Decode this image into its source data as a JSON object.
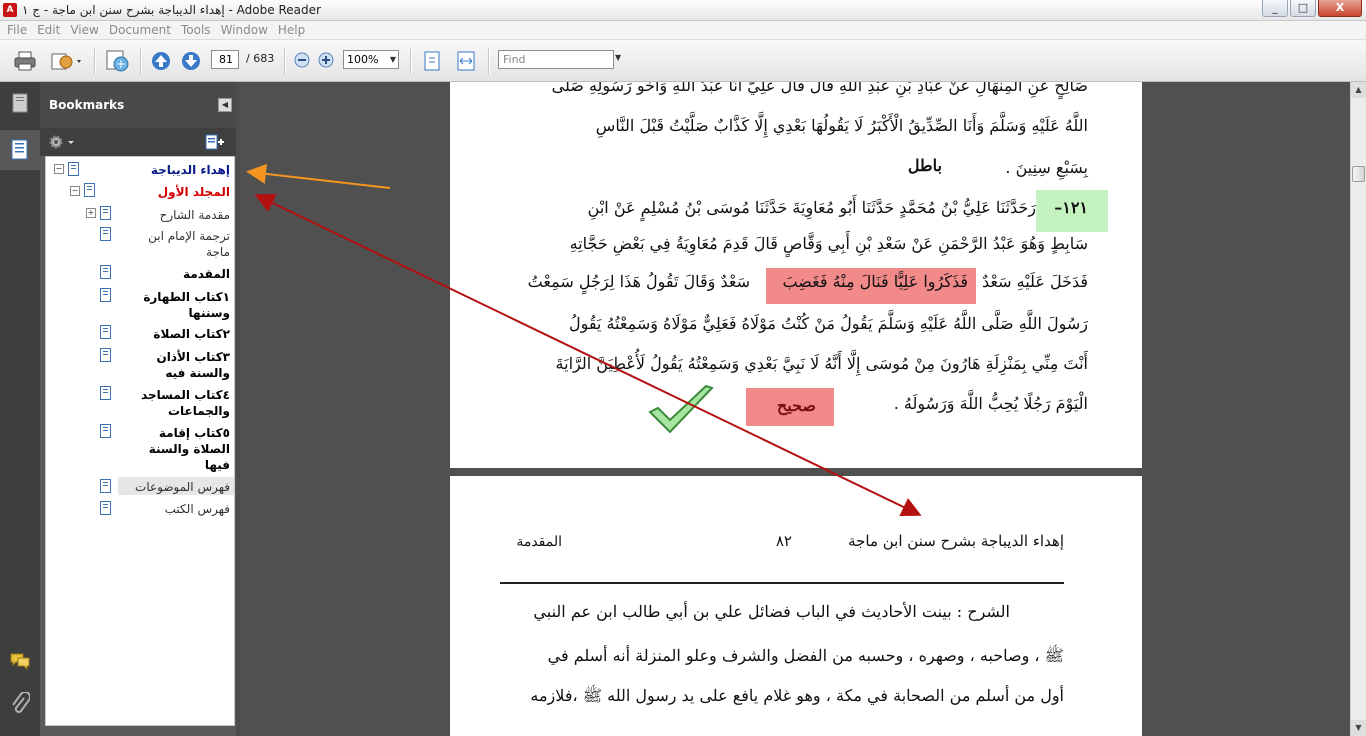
{
  "window": {
    "title": "إهداء الديباجة بشرح سنن ابن ماجة - ج ١ - Adobe Reader",
    "controls": {
      "minimize": "_",
      "maximize": "□",
      "close": "X"
    }
  },
  "menu": [
    "File",
    "Edit",
    "View",
    "Document",
    "Tools",
    "Window",
    "Help"
  ],
  "toolbar": {
    "page_current": "81",
    "page_total": "/ 683",
    "zoom": "100%",
    "find_placeholder": "Find"
  },
  "panel": {
    "title": "Bookmarks",
    "bookmarks": [
      {
        "label": "إهداء الديباجة",
        "color": "#0a1a8c"
      },
      {
        "label": "المجلد الأول",
        "color": "#d40000"
      },
      {
        "label": "مقدمة الشارح",
        "color": "#333333"
      },
      {
        "label": "ترجمة الإمام ابن",
        "label2": "ماجة",
        "color": "#333333"
      },
      {
        "label": "المقدمة",
        "color": "#000000"
      },
      {
        "label": "١كتاب الطهارة",
        "label2": "وسننها",
        "color": "#000000"
      },
      {
        "label": "٢كتاب الصلاة",
        "color": "#000000"
      },
      {
        "label": "٣كتاب الأذان",
        "label2": "والسنة فيه",
        "color": "#000000"
      },
      {
        "label": "٤كتاب المساجد",
        "label2": "والجماعات",
        "color": "#000000"
      },
      {
        "label": "٥كتاب إقامة",
        "label2": "الصلاة والسنة",
        "label3": "فيها",
        "color": "#000000"
      },
      {
        "label": "فهرس الموضوعات",
        "color": "#333333"
      },
      {
        "label": "فهرس الكتب",
        "color": "#333333"
      }
    ]
  },
  "page1": {
    "lines": [
      "صَالِحٍ عَنِ الْمِنْهَالِ عَنْ عَبَّادِ بْنِ عَبْدِ اللَّهِ قَالَ قَالَ عَلِيٌّ أَنَا عَبْدُ اللَّهِ وَأَخُو رَسُولِهِ صَلَّى",
      "اللَّهُ عَلَيْهِ وَسَلَّمَ وَأَنَا الصِّدِّيقُ الْأَكْبَرُ لَا يَقُولُهَا بَعْدِي إِلَّا كَذَّابٌ صَلَّيْتُ قَبْلَ النَّاسِ",
      "بِسَبْعِ سِنِينَ .",
      "رَحَدَّثَنَا عَلِيُّ بْنُ مُحَمَّدٍ حَدَّثَنَا أَبُو مُعَاوِيَةَ حَدَّثَنَا مُوسَى بْنُ مُسْلِمٍ عَنْ ابْنِ",
      "سَابِطٍ وَهُوَ عَبْدُ الرَّحْمَنِ عَنْ سَعْدِ بْنِ أَبِي وَقَّاصٍ قَالَ قَدِمَ مُعَاوِيَةُ فِي بَعْضِ حَجَّاتِهِ",
      "فَدَخَلَ عَلَيْهِ سَعْدٌ",
      "فَذَكَرُوا عَلِيًّا فَنَالَ مِنْهُ فَغَضِبَ",
      "سَعْدٌ وَقَالَ تَقُولُ هَذَا لِرَجُلٍ سَمِعْتُ",
      "رَسُولَ اللَّهِ صَلَّى اللَّهُ عَلَيْهِ وَسَلَّمَ يَقُولُ مَنْ كُنْتُ مَوْلَاهُ فَعَلِيٌّ مَوْلَاهُ وَسَمِعْتُهُ يَقُولُ",
      "أَنْتَ مِنِّي بِمَنْزِلَةِ هَارُونَ مِنْ مُوسَى إِلَّا أَنَّهُ لَا نَبِيَّ بَعْدِي وَسَمِعْتُهُ يَقُولُ لَأُعْطِيَنَّ الرَّايَةَ",
      "الْيَوْمَ رَجُلًا يُحِبُّ اللَّهَ وَرَسُولَهُ ."
    ],
    "batil_label": "باطل",
    "hadith_number": "١٢١–",
    "sahih_label": "صحيح"
  },
  "page2": {
    "header_title": "إهداء الديباجة بشرح سنن ابن ماجة",
    "header_page": "٨٢",
    "header_section": "المقدمة",
    "lines": [
      "الشرح : بينت الأحاديث في الباب فضائل علي بن أبي طالب ابن عم النبي",
      "ﷺ ، وصاحبه ، وصهره ، وحسبه من الفضل والشرف وعلو المنزلة أنه أسلم في",
      "أول من أسلم من الصحابة في مكة ، وهو غلام يافع على يد رسول الله ﷺ ،فلازمه"
    ]
  },
  "colors": {
    "green_highlight": "#c4f2c0",
    "red_highlight": "#f28a8a",
    "arrow_orange": "#f5951f",
    "arrow_red": "#b3100f"
  }
}
